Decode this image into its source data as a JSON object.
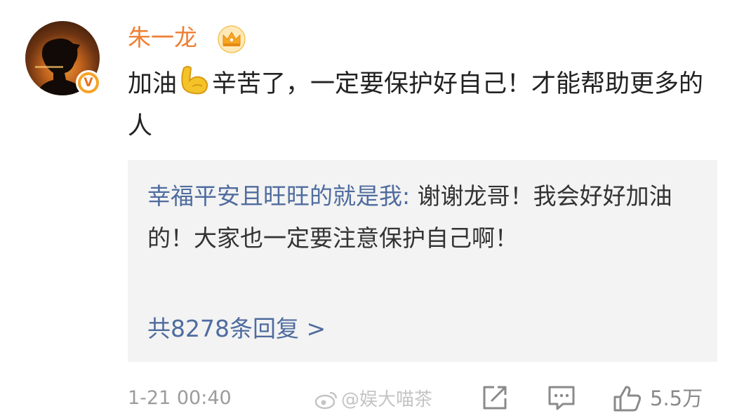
{
  "comment": {
    "username": "朱一龙",
    "text_before": "加油",
    "text_after": "辛苦了，一定要保护好自己！才能帮助更多的人",
    "timestamp": "1-21 00:40",
    "likes": "5.5万"
  },
  "reply": {
    "user": "幸福平安且旺旺的就是我:",
    "text": " 谢谢龙哥！我会好好加油的！大家也一定要注意保护自己啊！",
    "more": "共8278条回复 >"
  },
  "watermark": "@娱大喵茶",
  "colors": {
    "username": "#ef7f33",
    "link": "#4f6c9f",
    "reply_bg": "#f3f3f3",
    "muted": "#9c9c9c"
  },
  "icons": {
    "verified": "v-badge",
    "crown": "crown-icon",
    "emoji": "flexed-biceps",
    "share": "share-icon",
    "comment": "comment-icon",
    "like": "thumbs-up-icon"
  }
}
